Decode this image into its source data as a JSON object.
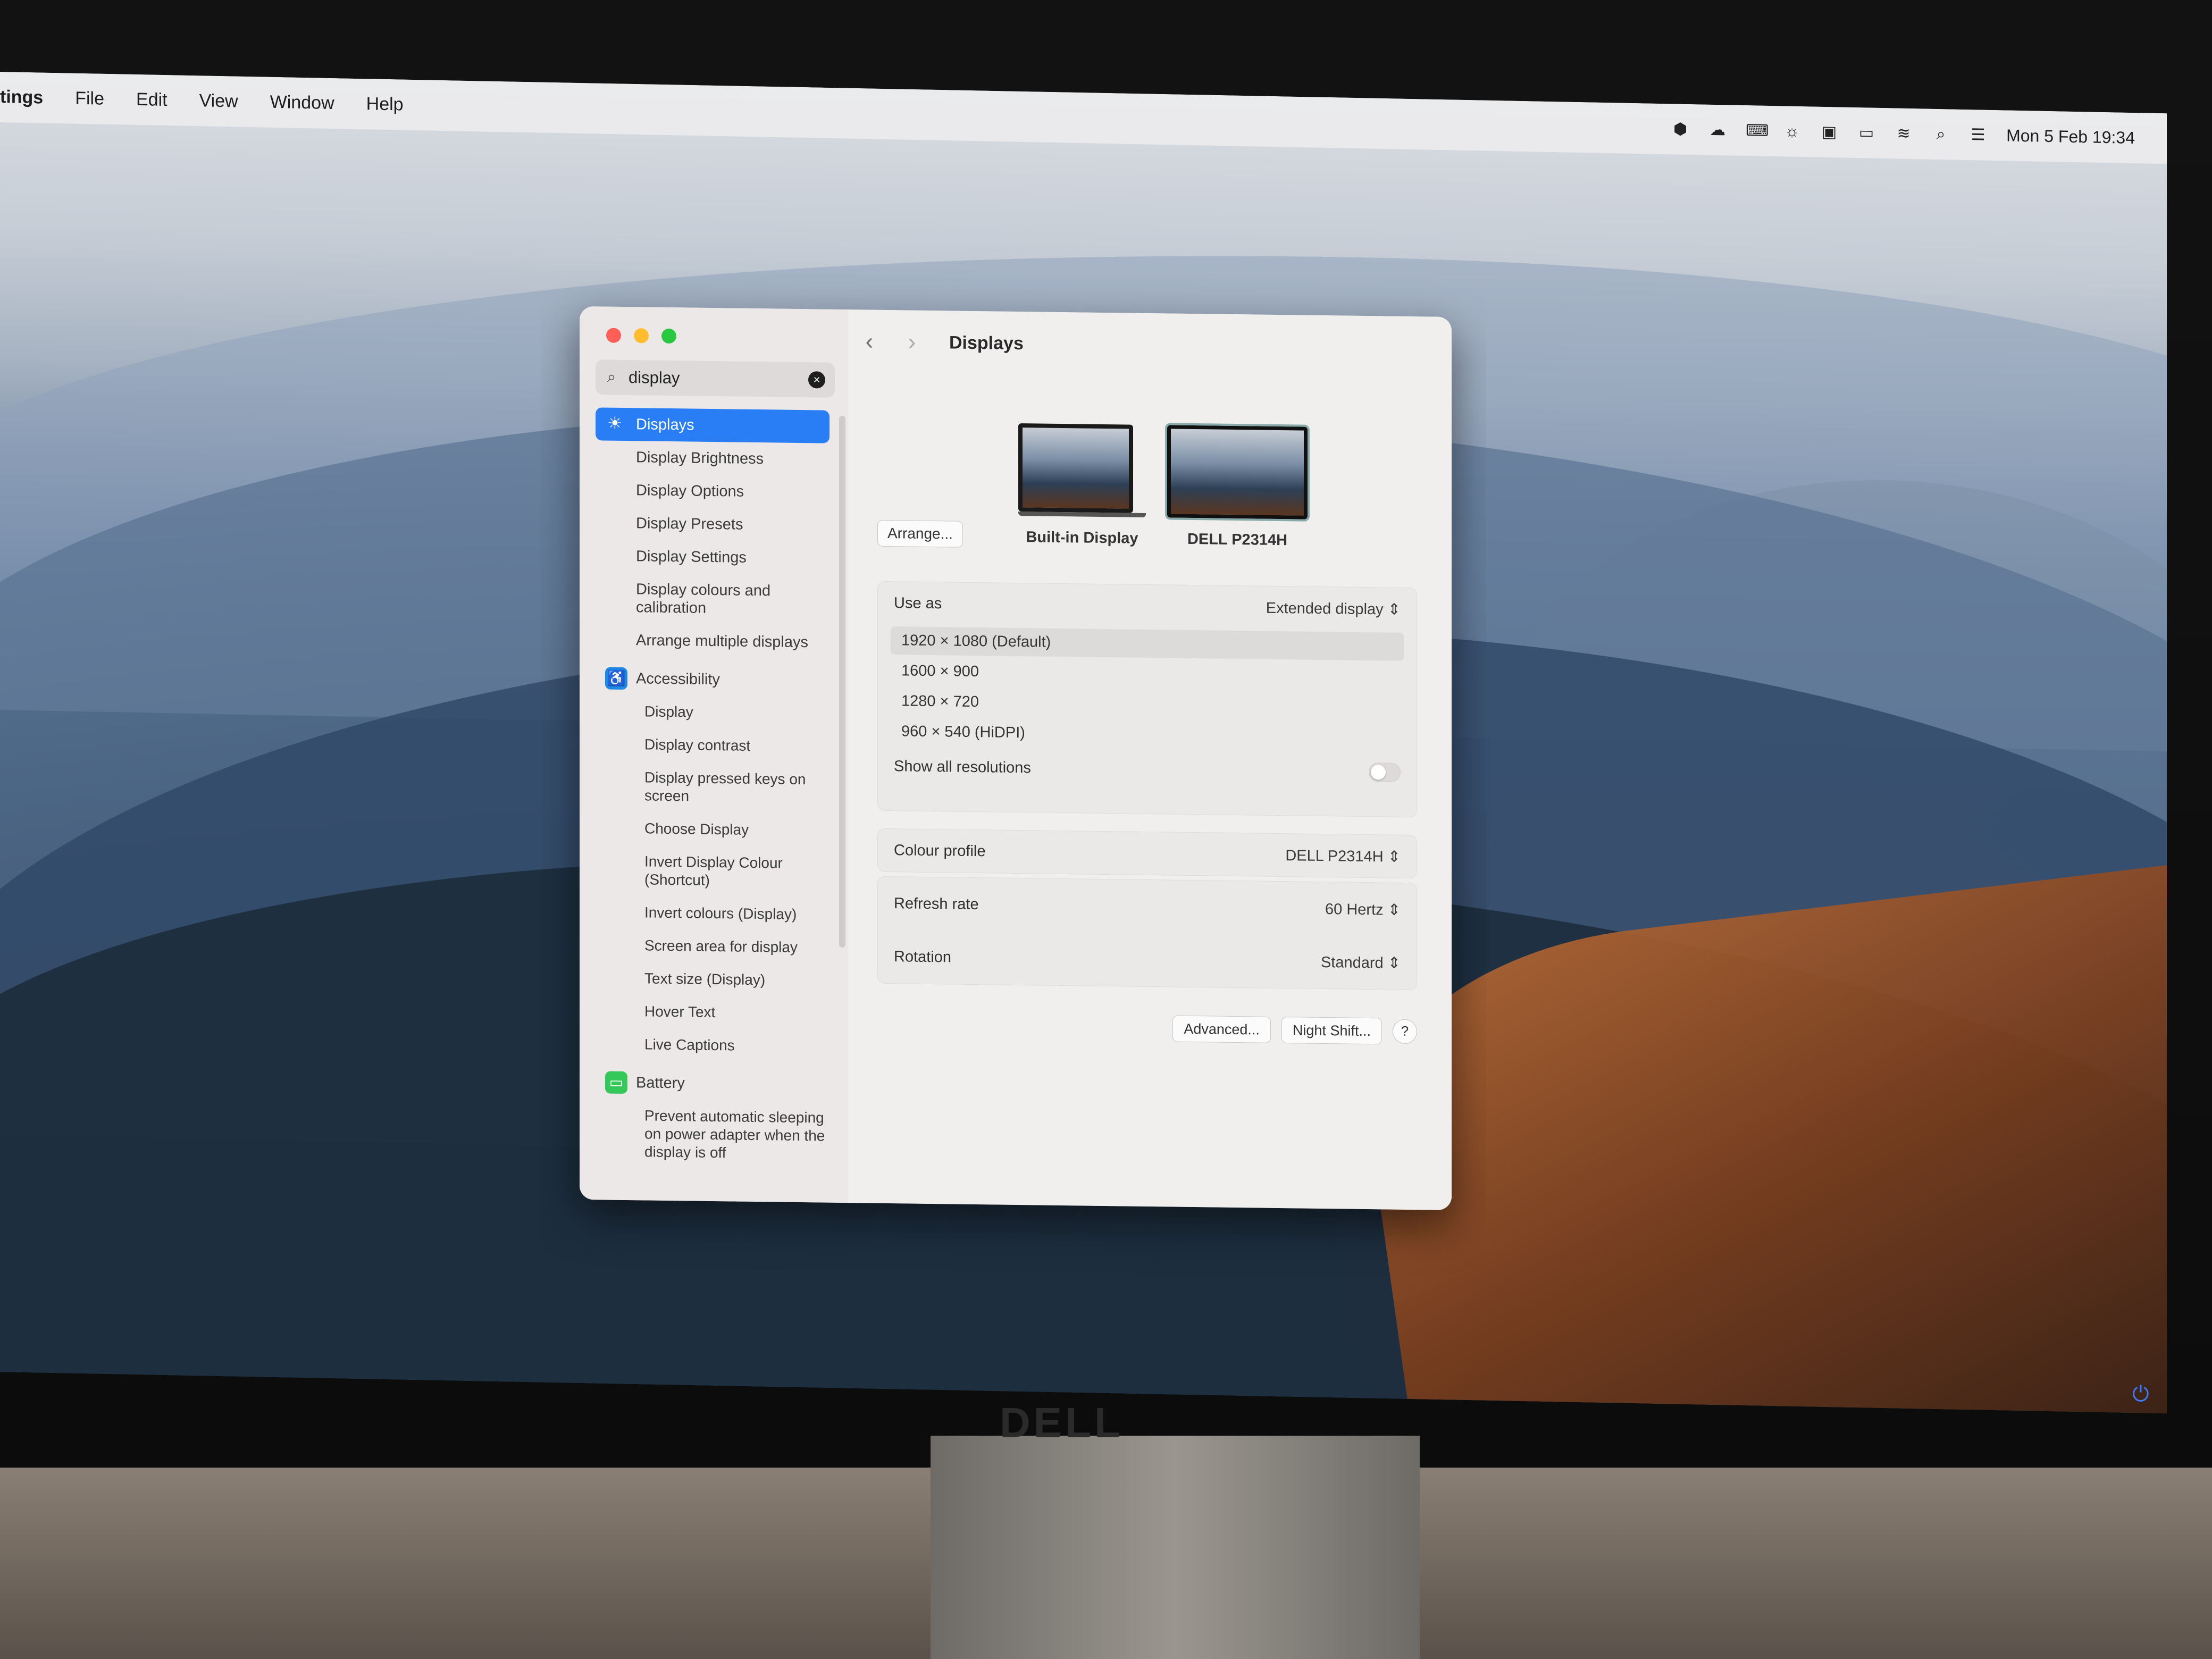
{
  "menubar": {
    "app_name": "tings",
    "menus": [
      "File",
      "Edit",
      "View",
      "Window",
      "Help"
    ],
    "clock": "Mon 5 Feb  19:34",
    "status_icons": [
      "app-icon",
      "cloud-icon",
      "keyboard-icon",
      "brightness-icon",
      "outlook-icon",
      "battery-icon",
      "wifi-icon",
      "search-icon",
      "control-center-icon"
    ]
  },
  "sidebar": {
    "search_value": "display",
    "items": [
      {
        "label": "Displays",
        "type": "selected",
        "icon": "sun-icon"
      },
      {
        "label": "Display Brightness",
        "type": "item"
      },
      {
        "label": "Display Options",
        "type": "item"
      },
      {
        "label": "Display Presets",
        "type": "item"
      },
      {
        "label": "Display Settings",
        "type": "item"
      },
      {
        "label": "Display colours and calibration",
        "type": "item"
      },
      {
        "label": "Arrange multiple displays",
        "type": "item"
      },
      {
        "label": "Accessibility",
        "type": "cat",
        "icon": "accessibility-icon",
        "color": "#1e88e5"
      },
      {
        "label": "Display",
        "type": "sub"
      },
      {
        "label": "Display contrast",
        "type": "sub"
      },
      {
        "label": "Display pressed keys on screen",
        "type": "sub"
      },
      {
        "label": "Choose Display",
        "type": "sub"
      },
      {
        "label": "Invert Display Colour (Shortcut)",
        "type": "sub"
      },
      {
        "label": "Invert colours (Display)",
        "type": "sub"
      },
      {
        "label": "Screen area for display",
        "type": "sub"
      },
      {
        "label": "Text size (Display)",
        "type": "sub"
      },
      {
        "label": "Hover Text",
        "type": "sub"
      },
      {
        "label": "Live Captions",
        "type": "sub"
      },
      {
        "label": "Battery",
        "type": "cat",
        "icon": "battery-icon",
        "color": "#34c759"
      },
      {
        "label": "Prevent automatic sleeping on power adapter when the display is off",
        "type": "sub"
      }
    ]
  },
  "main": {
    "title": "Displays",
    "arrange_label": "Arrange...",
    "displays": [
      {
        "label": "Built-in Display"
      },
      {
        "label": "DELL P2314H"
      }
    ],
    "use_as_label": "Use as",
    "use_as_value": "Extended display",
    "resolutions": [
      "1920 × 1080 (Default)",
      "1600 × 900",
      "1280 × 720",
      "960 × 540 (HiDPI)"
    ],
    "show_all_label": "Show all resolutions",
    "colour_profile_label": "Colour profile",
    "colour_profile_value": "DELL P2314H",
    "refresh_rate_label": "Refresh rate",
    "refresh_rate_value": "60 Hertz",
    "rotation_label": "Rotation",
    "rotation_value": "Standard",
    "advanced_label": "Advanced...",
    "night_shift_label": "Night Shift...",
    "help_label": "?"
  },
  "hardware": {
    "brand": "DELL"
  }
}
